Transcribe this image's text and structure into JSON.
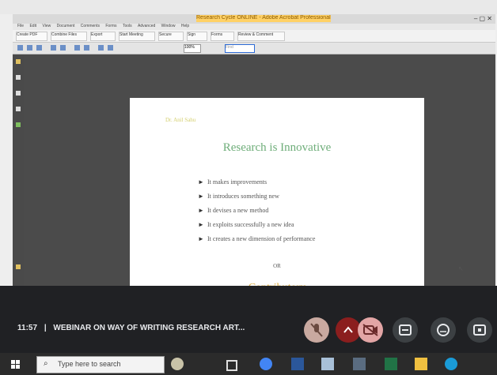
{
  "app": {
    "title": "Research Cycle ONLINE - Adobe Acrobat Professional"
  },
  "menu": {
    "items": [
      "File",
      "Edit",
      "View",
      "Document",
      "Comments",
      "Forms",
      "Tools",
      "Advanced",
      "Window",
      "Help"
    ]
  },
  "toolbar": {
    "buttons": [
      "Create PDF",
      "Combine Files",
      "Export",
      "Start Meeting",
      "Secure",
      "Sign",
      "Forms",
      "Review & Comment"
    ],
    "zoom_value": "100%",
    "find_placeholder": "Find"
  },
  "slide": {
    "header_note": "Dr. Anil Sahu",
    "title": "Research is Innovative",
    "bullets": [
      "It makes improvements",
      "It introduces something new",
      "It devises a new method",
      "It exploits successfully a new idea",
      "It creates a new dimension of performance"
    ],
    "or_text": "OR",
    "subtitle": "Contributory"
  },
  "meet": {
    "time": "11:57",
    "separator": "|",
    "meeting_title": "WEBINAR ON WAY OF WRITING RESEARCH ART..."
  },
  "taskbar": {
    "search_placeholder": "Type here to search"
  }
}
